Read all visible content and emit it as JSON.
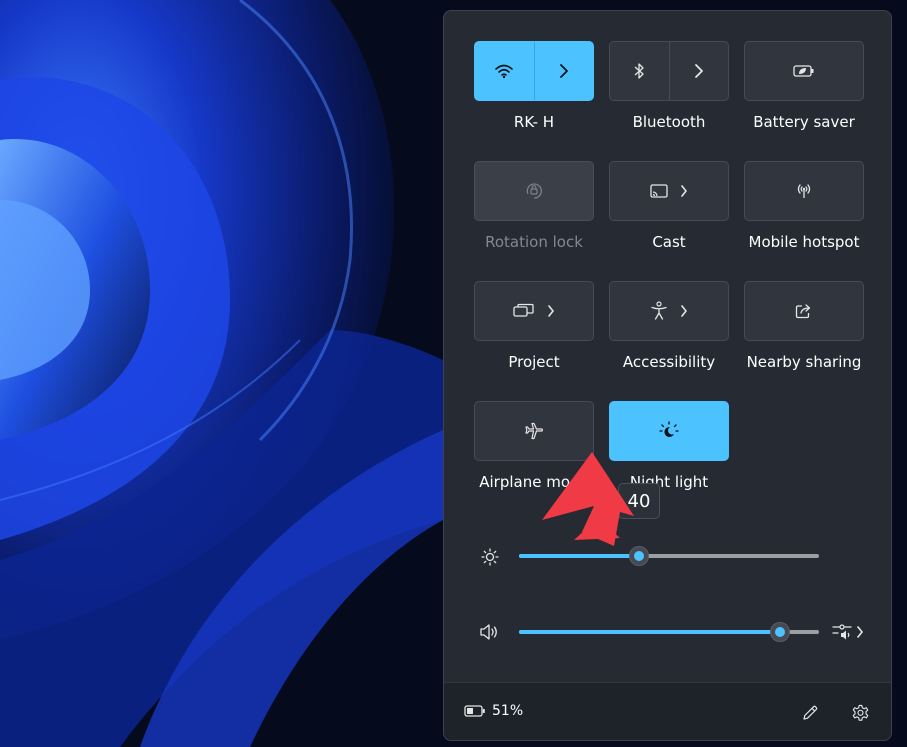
{
  "quick_settings": {
    "tiles": [
      {
        "label": "RK- H",
        "icon": "wifi-icon",
        "state": "on",
        "has_chevron": true
      },
      {
        "label": "Bluetooth",
        "icon": "bluetooth-icon",
        "state": "off",
        "has_chevron": true
      },
      {
        "label": "Battery saver",
        "icon": "battery-saver-icon",
        "state": "off",
        "has_chevron": false
      },
      {
        "label": "Rotation lock",
        "icon": "rotation-lock-icon",
        "state": "disabled",
        "has_chevron": false
      },
      {
        "label": "Cast",
        "icon": "cast-icon",
        "state": "off",
        "has_chevron": true
      },
      {
        "label": "Mobile hotspot",
        "icon": "hotspot-icon",
        "state": "off",
        "has_chevron": false
      },
      {
        "label": "Project",
        "icon": "project-icon",
        "state": "off",
        "has_chevron": true
      },
      {
        "label": "Accessibility",
        "icon": "accessibility-icon",
        "state": "off",
        "has_chevron": true
      },
      {
        "label": "Nearby sharing",
        "icon": "share-icon",
        "state": "off",
        "has_chevron": false
      },
      {
        "label": "Airplane mode",
        "icon": "airplane-icon",
        "state": "off",
        "has_chevron": false
      },
      {
        "label": "Night light",
        "icon": "night-light-icon",
        "state": "on",
        "has_chevron": false
      }
    ],
    "brightness": {
      "icon": "sun-icon",
      "value": 40,
      "tooltip": "40"
    },
    "volume": {
      "icon": "speaker-icon",
      "value": 87,
      "output_icon": "audio-output-icon"
    },
    "footer": {
      "battery_icon": "battery-icon",
      "battery_text": "51%",
      "edit_icon": "pencil-icon",
      "settings_icon": "gear-icon"
    }
  },
  "colors": {
    "accent": "#4cc2ff",
    "panel": "#252a33",
    "tile": "#30353e",
    "annotation_arrow": "#f03a45"
  }
}
